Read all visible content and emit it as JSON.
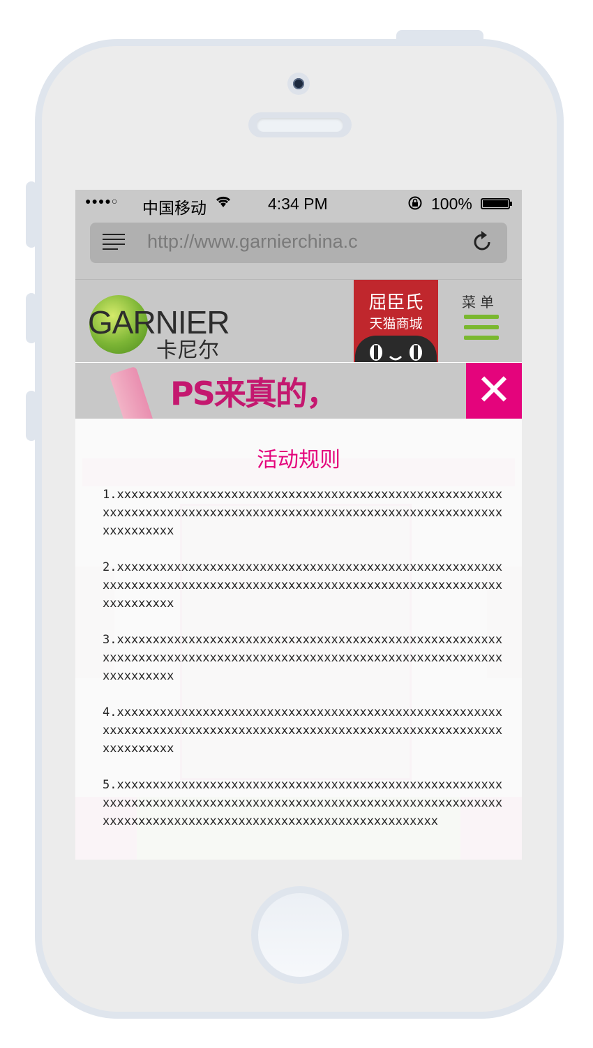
{
  "status_bar": {
    "signal": "●●●●○",
    "carrier": "中国移动",
    "time": "4:34 PM",
    "battery": "100%"
  },
  "browser": {
    "url": "http://www.garnierchina.c"
  },
  "header": {
    "logo_text": "GARNIER",
    "logo_cn": "卡尼尔",
    "tmall_line1": "屈臣氏",
    "tmall_line2": "天猫商城",
    "menu_label": "菜单"
  },
  "banner": {
    "title": "PS来真的，"
  },
  "modal": {
    "close_glyph": "✕",
    "title": "活动规则",
    "rules": [
      "1.xxxxxxxxxxxxxxxxxxxxxxxxxxxxxxxxxxxxxxxxxxxxxxxxxxxxxxxxxxxxxxxxxxxxxxxxxxxxxxxxxxxxxxxxxxxxxxxxxxxxxxxxxxxxxxxxxxxxxxxx",
      "2.xxxxxxxxxxxxxxxxxxxxxxxxxxxxxxxxxxxxxxxxxxxxxxxxxxxxxxxxxxxxxxxxxxxxxxxxxxxxxxxxxxxxxxxxxxxxxxxxxxxxxxxxxxxxxxxxxxxxxxxx",
      "3.xxxxxxxxxxxxxxxxxxxxxxxxxxxxxxxxxxxxxxxxxxxxxxxxxxxxxxxxxxxxxxxxxxxxxxxxxxxxxxxxxxxxxxxxxxxxxxxxxxxxxxxxxxxxxxxxxxxxxxxx",
      "4.xxxxxxxxxxxxxxxxxxxxxxxxxxxxxxxxxxxxxxxxxxxxxxxxxxxxxxxxxxxxxxxxxxxxxxxxxxxxxxxxxxxxxxxxxxxxxxxxxxxxxxxxxxxxxxxxxxxxxxxx",
      "5.xxxxxxxxxxxxxxxxxxxxxxxxxxxxxxxxxxxxxxxxxxxxxxxxxxxxxxxxxxxxxxxxxxxxxxxxxxxxxxxxxxxxxxxxxxxxxxxxxxxxxxxxxxxxxxxxxxxxxxxxxxxxxxxxxxxxxxxxxxxxxxxxxxxxxxxxxxxxx"
    ]
  },
  "colors": {
    "accent": "#e4047c",
    "brand_green": "#7ab82f",
    "tmall_red": "#c0272d"
  },
  "icons": [
    "wifi-icon",
    "orientation-lock-icon",
    "battery-icon",
    "reader-menu-icon",
    "reload-icon",
    "hamburger-menu-icon",
    "close-icon"
  ]
}
